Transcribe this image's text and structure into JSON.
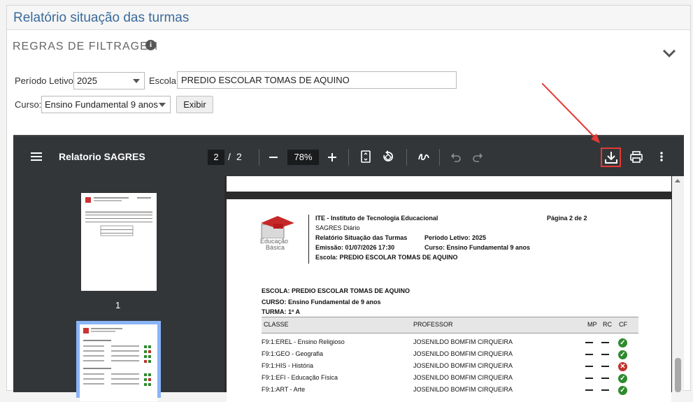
{
  "panel": {
    "title": "Relatório situação das turmas"
  },
  "filters": {
    "section_title": "REGRAS DE FILTRAGEM",
    "periodo_label": "Período Letivo:",
    "periodo_value": "2025",
    "escola_label": "Escola:",
    "escola_value": "PREDIO ESCOLAR TOMAS DE AQUINO",
    "curso_label": "Curso:",
    "curso_value": "Ensino Fundamental 9 anos",
    "exibir_label": "Exibir"
  },
  "viewer": {
    "doc_title": "Relatorio SAGRES",
    "current_page": "2",
    "page_sep": "/",
    "total_pages": "2",
    "zoom": "78%",
    "thumb1_label": "1"
  },
  "report": {
    "logo_text1": "Educação",
    "logo_text2": "Básica",
    "institute": "ITE - Instituto de Tecnologia Educacional",
    "page_label": "Página 2 de  2",
    "system": "SAGRES Diário",
    "report_name": "Relatório Situação das Turmas",
    "periodo": "Período Letivo:  2025",
    "emissao": "Emissão:  01/07/2026 17:30",
    "curso": "Curso:  Ensino Fundamental 9 anos",
    "escola": "Escola:     PREDIO ESCOLAR TOMAS DE AQUINO",
    "escola2": "ESCOLA: PREDIO ESCOLAR TOMAS DE AQUINO",
    "curso2": "CURSO:  Ensino Fundamental de 9 anos",
    "turma": "TURMA:   1º A",
    "col_classe": "CLASSE",
    "col_professor": "PROFESSOR",
    "col_mp": "MP",
    "col_rc": "RC",
    "col_cf": "CF",
    "rows": [
      {
        "classe": "F9:1:EREL - Ensino Religioso",
        "professor": "JOSENILDO BOMFIM CIRQUEIRA",
        "cf": "ok"
      },
      {
        "classe": "F9:1:GEO - Geografia",
        "professor": "JOSENILDO BOMFIM CIRQUEIRA",
        "cf": "ok"
      },
      {
        "classe": "F9:1:HIS - História",
        "professor": "JOSENILDO BOMFIM CIRQUEIRA",
        "cf": "bad"
      },
      {
        "classe": "F9:1:EFI - Educação Física",
        "professor": "JOSENILDO BOMFIM CIRQUEIRA",
        "cf": "ok"
      },
      {
        "classe": "F9:1:ART - Arte",
        "professor": "JOSENILDO BOMFIM CIRQUEIRA",
        "cf": "ok"
      }
    ]
  },
  "colors": {
    "title": "#3a6a9a",
    "ok": "#2e8b2e",
    "bad": "#c0302b",
    "highlight": "#e53935",
    "toolbar": "#323639"
  }
}
